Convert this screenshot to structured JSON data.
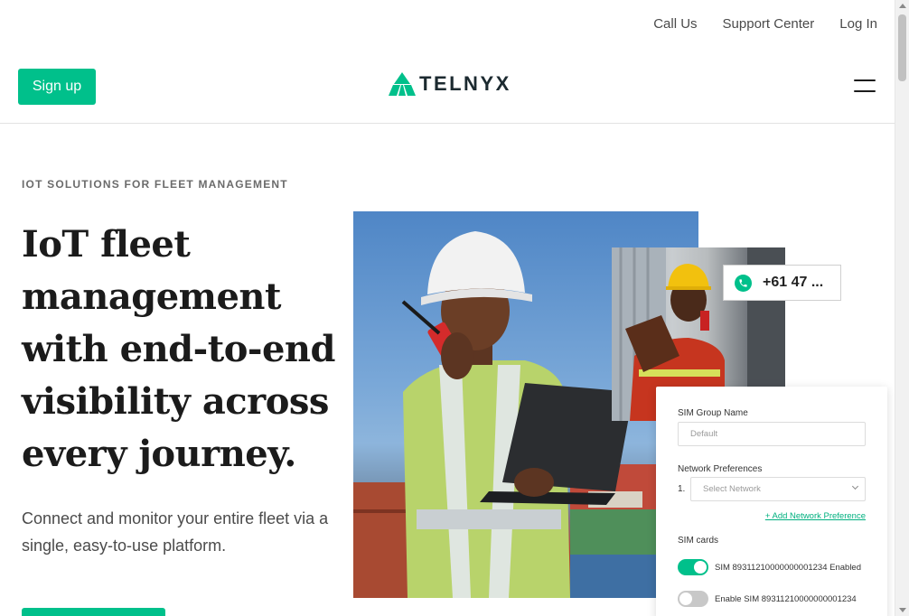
{
  "topnav": {
    "call_us": "Call Us",
    "support": "Support Center",
    "login": "Log In"
  },
  "header": {
    "signup": "Sign up",
    "brand": "TELNYX"
  },
  "hero": {
    "eyebrow": "IOT SOLUTIONS FOR FLEET MANAGEMENT",
    "headline": "IoT fleet management with end-to-end visibility across every journey.",
    "subtitle": "Connect and monitor your entire fleet via a single, easy-to-use platform."
  },
  "phone_card": {
    "number": "+61 47 ..."
  },
  "sim_form": {
    "group_label": "SIM Group Name",
    "group_placeholder": "Default",
    "network_label": "Network Preferences",
    "network_index": "1.",
    "network_placeholder": "Select Network",
    "add_link": "+ Add Network Preference",
    "sim_cards_label": "SIM cards",
    "sims": [
      {
        "text": "SIM 89311210000000001234 Enabled",
        "enabled": true
      },
      {
        "text": "Enable SIM 89311210000000001234",
        "enabled": false
      }
    ]
  },
  "colors": {
    "accent": "#00c08b",
    "text": "#1c1c1c"
  }
}
